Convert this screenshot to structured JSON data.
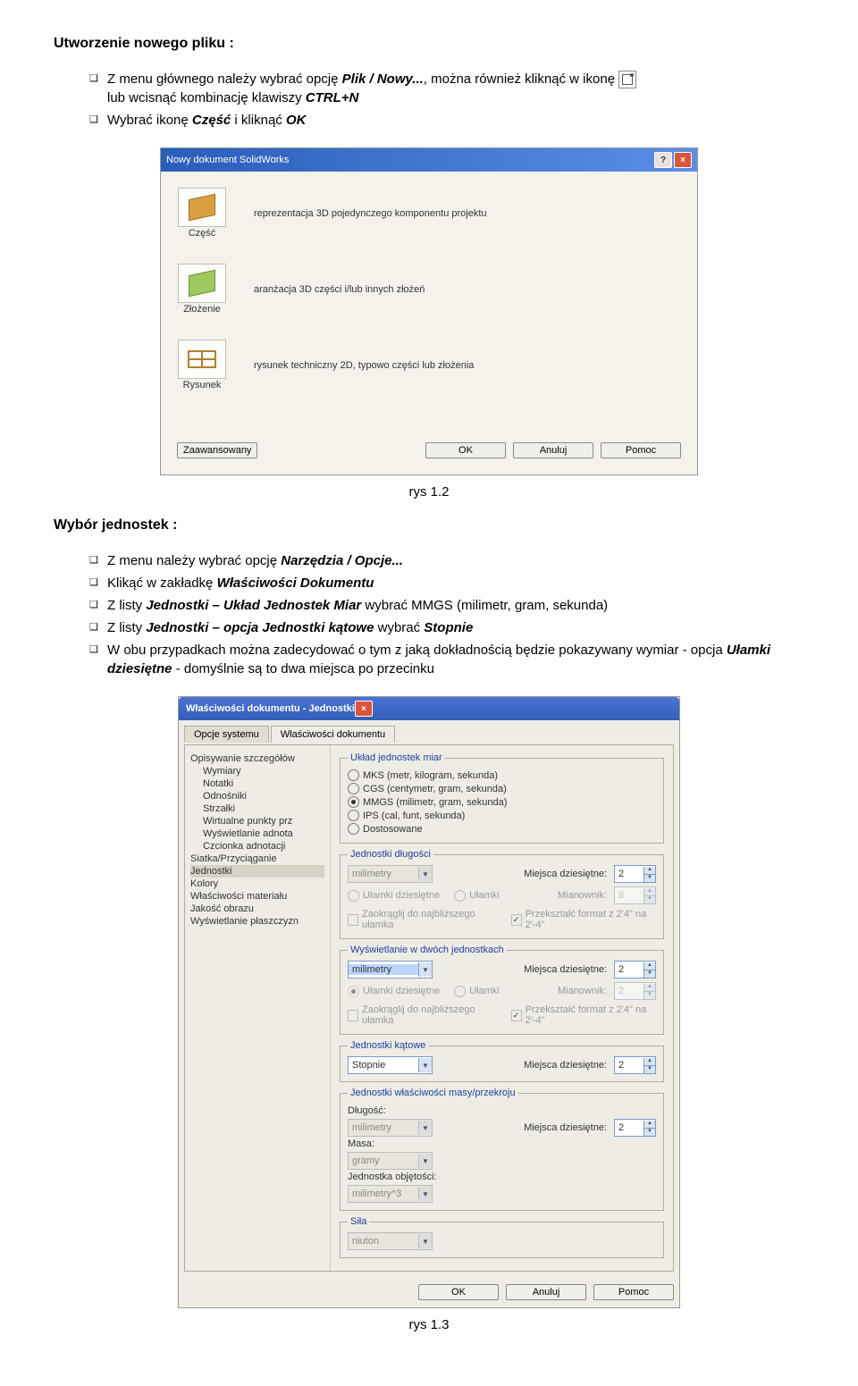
{
  "doc": {
    "heading1": "Utworzenie nowego pliku :",
    "list1": [
      {
        "pre": "Z menu głównego należy wybrać opcję ",
        "bi": "Plik / Nowy...",
        "post": ", można również kliknąć w ikonę",
        "hasicon": true
      },
      {
        "pre": "lub wcisnąć kombinację klawiszy ",
        "bi": "CTRL+N",
        "post": "",
        "continuation": true
      },
      {
        "pre": "Wybrać ikonę ",
        "bi": "Część",
        "post": " i kliknąć ",
        "bi2": "OK"
      }
    ],
    "heading2": "Wybór jednostek :",
    "list2": [
      {
        "pre": "Z menu należy wybrać opcję ",
        "bi": "Narzędzia / Opcje..."
      },
      {
        "pre": "Klikąć w zakładkę ",
        "bi": "Właściwości Dokumentu"
      },
      {
        "pre": "Z listy ",
        "bi": "Jednostki – Układ Jednostek Miar",
        "post": " wybrać MMGS (milimetr, gram, sekunda)"
      },
      {
        "pre": "Z listy ",
        "bi": "Jednostki – opcja Jednostki kątowe",
        "post": " wybrać ",
        "bi2": "Stopnie"
      },
      {
        "pre": "W obu przypadkach można zadecydować o tym z jaką dokładnością będzie pokazywany wymiar - opcja ",
        "bi": "Ułamki dziesiętne",
        "post": " - domyślnie są to dwa miejsca po przecinku"
      }
    ],
    "caption1": "rys 1.2",
    "caption2": "rys 1.3"
  },
  "dlg1": {
    "title": "Nowy dokument SolidWorks",
    "opts": [
      {
        "label": "Część",
        "desc": "reprezentacja 3D pojedynczego komponentu projektu"
      },
      {
        "label": "Złożenie",
        "desc": "aranżacja 3D części i/lub innych złożeń"
      },
      {
        "label": "Rysunek",
        "desc": "rysunek techniczny 2D, typowo części lub złożenia"
      }
    ],
    "advanced": "Zaawansowany",
    "ok": "OK",
    "cancel": "Anuluj",
    "help": "Pomoc"
  },
  "dlg2": {
    "title": "Właściwości dokumentu - Jednostki",
    "tab_system": "Opcje systemu",
    "tab_doc": "Właściwości dokumentu",
    "tree": {
      "root1": "Opisywanie szczegółów",
      "c1": "Wymiary",
      "c2": "Notatki",
      "c3": "Odnośniki",
      "c4": "Strzałki",
      "c5": "Wirtualne punkty prz",
      "c6": "Wyświetlanie adnota",
      "c7": "Czcionka adnotacji",
      "root2": "Siatka/Przyciąganie",
      "sel": "Jednostki",
      "n1": "Kolory",
      "n2": "Właściwości materiału",
      "n3": "Jakość obrazu",
      "n4": "Wyświetlanie płaszczyzn"
    },
    "group_units": "Układ jednostek miar",
    "r1": "MKS (metr, kilogram, sekunda)",
    "r2": "CGS (centymetr, gram, sekunda)",
    "r3": "MMGS (milimetr, gram, sekunda)",
    "r4": "IPS (cal, funt, sekunda)",
    "r5": "Dostosowane",
    "group_len": "Jednostki długości",
    "len_unit": "milimetry",
    "dec_places_lbl": "Miejsca dziesiętne:",
    "dec_frac": "Ułamki dziesiętne",
    "frac": "Ułamki",
    "denom": "Mianownik:",
    "round_nearest": "Zaokrąglij do najbliższego ułamka",
    "convert_fmt": "Przekształć format z 2'4\" na 2'-4\"",
    "group_dual": "Wyświetlanie w dwóch jednostkach",
    "dual_unit": "milimetry",
    "group_ang": "Jednostki kątowe",
    "ang_unit": "Stopnie",
    "group_mass": "Jednostki właściwości masy/przekroju",
    "len_lbl": "Długość:",
    "mass_lbl": "Masa:",
    "vol_lbl": "Jednostka objętości:",
    "mass_unit": "gramy",
    "vol_unit": "milimetry^3",
    "group_force": "Siła",
    "force_unit": "niuton",
    "val2": "2",
    "val8": "8",
    "ok": "OK",
    "cancel": "Anuluj",
    "help": "Pomoc"
  }
}
